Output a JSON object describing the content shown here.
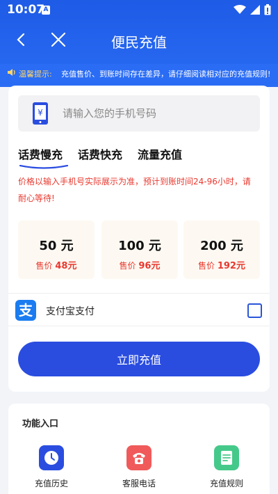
{
  "status_bar": {
    "time": "10:07",
    "badge": "A"
  },
  "nav": {
    "title": "便民充值"
  },
  "notice": {
    "label": "温馨提示:",
    "text": "充值售价、到账时间存在差异，请仔细阅读相对应的充值规则!"
  },
  "phone": {
    "placeholder": "请输入您的手机号码"
  },
  "tabs": [
    {
      "label": "话费慢充"
    },
    {
      "label": "话费快充"
    },
    {
      "label": "流量充值"
    }
  ],
  "tip": "价格以输入手机号实际展示为准，预计到账时间24-96小时，请耐心等待!",
  "products": [
    {
      "face": "50 元",
      "price_prefix": "售价",
      "price": "48元"
    },
    {
      "face": "100 元",
      "price_prefix": "售价",
      "price": "96元"
    },
    {
      "face": "200 元",
      "price_prefix": "售价",
      "price": "192元"
    }
  ],
  "payment": {
    "icon_char": "支",
    "label": "支付宝支付",
    "checked": false
  },
  "submit_label": "立即充值",
  "functions": {
    "title": "功能入口",
    "items": [
      {
        "label": "充值历史",
        "icon": "clock-icon",
        "color": "#2a4de0"
      },
      {
        "label": "客服电话",
        "icon": "phone-icon",
        "color": "#f05a5a"
      },
      {
        "label": "充值规则",
        "icon": "document-icon",
        "color": "#45c98a"
      }
    ]
  },
  "colors": {
    "primary": "#2a4de0",
    "header": "#1e5be6",
    "accent_red": "#e8392f",
    "notice_label": "#ffd66b"
  }
}
